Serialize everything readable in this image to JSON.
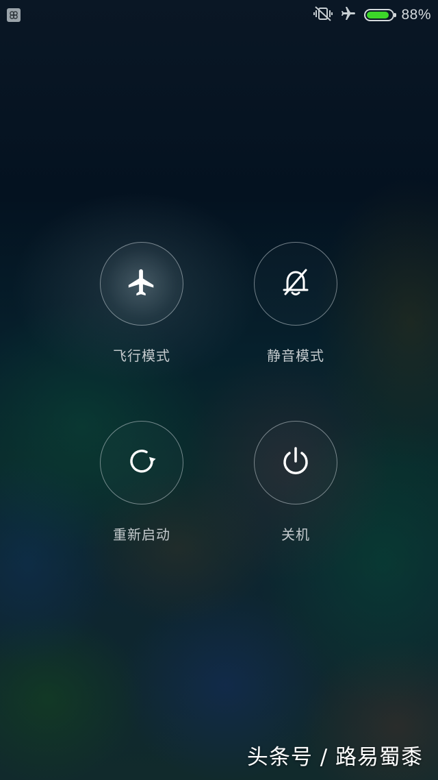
{
  "status_bar": {
    "icons": [
      "app-notification-icon",
      "vibrate-off-icon",
      "airplane-icon",
      "battery-icon"
    ],
    "battery_percent": "88%",
    "battery_level": 0.88,
    "battery_color": "#3cd629"
  },
  "power_menu": {
    "items": [
      {
        "label": "飞行模式",
        "icon": "airplane-icon",
        "state": "on"
      },
      {
        "label": "静音模式",
        "icon": "bell-off-icon",
        "state": "off"
      },
      {
        "label": "重新启动",
        "icon": "restart-icon"
      },
      {
        "label": "关机",
        "icon": "power-icon"
      }
    ]
  },
  "watermark": "头条号 / 路易蜀黍"
}
